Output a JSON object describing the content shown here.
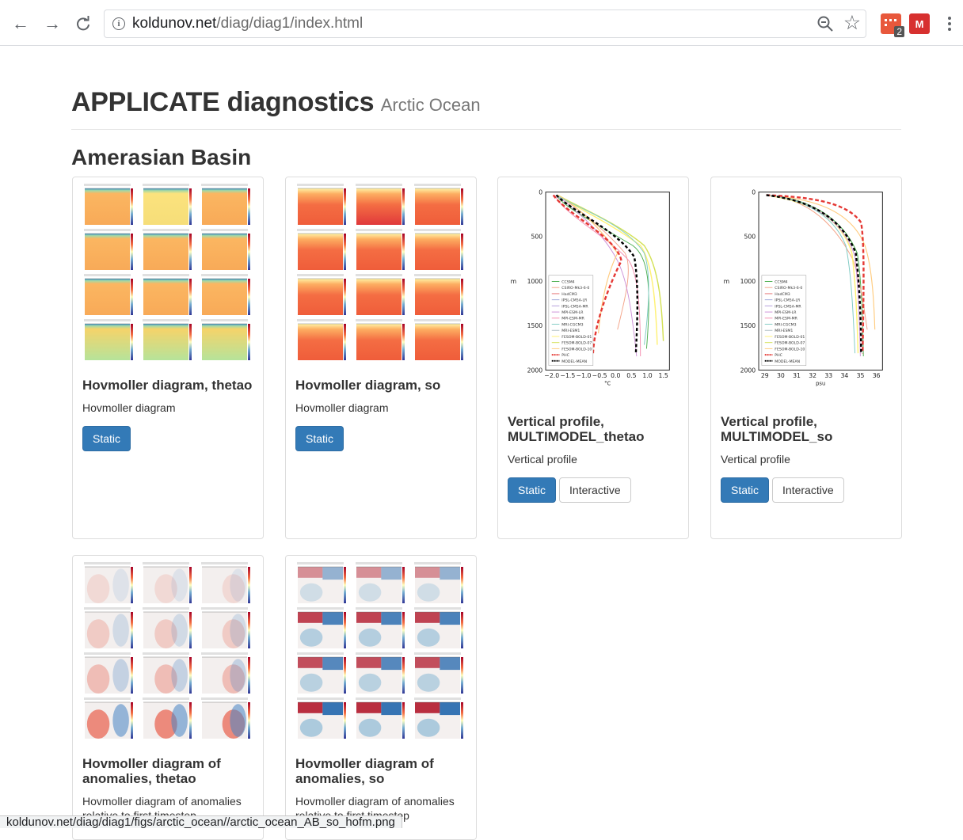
{
  "browser": {
    "url_domain": "koldunov.net",
    "url_path": "/diag/diag1/index.html",
    "extension_badge": "2",
    "extension2_label": "M"
  },
  "page": {
    "title": "APPLICATE diagnostics",
    "subtitle": "Arctic Ocean",
    "section": "Amerasian Basin"
  },
  "cards": [
    {
      "title": "Hovmoller diagram, thetao",
      "description": "Hovmoller diagram",
      "buttons": [
        "Static"
      ]
    },
    {
      "title": "Hovmoller diagram, so",
      "description": "Hovmoller diagram",
      "buttons": [
        "Static"
      ]
    },
    {
      "title": "Vertical profile, MULTIMODEL_thetao",
      "description": "Vertical profile",
      "buttons": [
        "Static",
        "Interactive"
      ]
    },
    {
      "title": "Vertical profile, MULTIMODEL_so",
      "description": "Vertical profile",
      "buttons": [
        "Static",
        "Interactive"
      ]
    },
    {
      "title": "Hovmoller diagram of anomalies, thetao",
      "description": "Hovmoller diagram of anomalies relative to first timestep",
      "buttons": []
    },
    {
      "title": "Hovmoller diagram of anomalies, so",
      "description": "Hovmoller diagram of anomalies relative to first timestep",
      "buttons": []
    }
  ],
  "profile_thetao": {
    "y_ticks": [
      "0",
      "500",
      "1000",
      "1500",
      "2000"
    ],
    "y_unit": "m",
    "x_ticks": [
      "−2.0",
      "−1.5",
      "−1.0",
      "−0.5",
      "0.0",
      "0.5",
      "1.0",
      "1.5"
    ],
    "x_unit": "°C"
  },
  "profile_so": {
    "y_ticks": [
      "0",
      "500",
      "1000",
      "1500",
      "2000"
    ],
    "y_unit": "m",
    "x_ticks": [
      "29",
      "30",
      "31",
      "32",
      "33",
      "34",
      "35",
      "36"
    ],
    "x_unit": "psu"
  },
  "legend": [
    "CCSM4",
    "CSIRO-Mk3-6-0",
    "HadCM3",
    "IPSL-CM5A-LR",
    "IPSL-CM5A-MR",
    "MPI-ESM-LR",
    "MPI-ESM-MR",
    "MRI-CGCM3",
    "MRI-ESM1",
    "FESOM-BOLD-01",
    "FESOM-BOLD-07",
    "FESOM-BOLD-10",
    "PHC",
    "MODEL-MEAN"
  ],
  "legend_colors": [
    "#4caf50",
    "#f4a58a",
    "#e57373",
    "#9fa8da",
    "#b39ddb",
    "#ce93d8",
    "#f48fb1",
    "#80cbc4",
    "#b0bec5",
    "#fff176",
    "#d4e157",
    "#ffcc80",
    "#e53935",
    "#000000"
  ],
  "status_url": "koldunov.net/diag/diag1/figs/arctic_ocean//arctic_ocean_AB_so_hofm.png"
}
